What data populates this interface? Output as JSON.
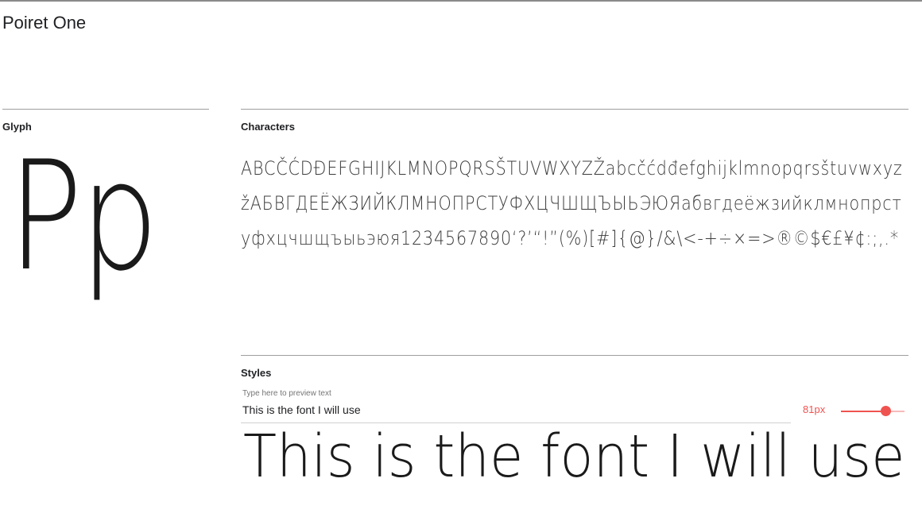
{
  "font": {
    "name": "Poiret One"
  },
  "glyph": {
    "label": "Glyph",
    "sample": "Pp"
  },
  "characters": {
    "label": "Characters",
    "text": "ABCČĆDĐEFGHIJKLMNOPQRSŠTUVWXYZŽabcčćdđefghijklmnopqrsštuvwxyzžАБВГДЕЁЖЗИЙКЛМНОПРСТУФХЦЧШЩЪЫЬЭЮЯабвгдеёжзийклмнопрстуфхцчшщъыьэюя1234567890‘?’“!”(%)[#]{@}/&\\<-+÷×=>®©$€£¥¢:;,.*"
  },
  "styles": {
    "label": "Styles",
    "input_hint": "Type here to preview text",
    "input_value": "This is the font I will use",
    "size_readout": "81px",
    "size_level": 0.7,
    "preview_text": "This is the font I will use"
  },
  "colors": {
    "accent": "#ef5350",
    "accent_light": "#f8bbbb",
    "rule": "#9e9e9e"
  }
}
